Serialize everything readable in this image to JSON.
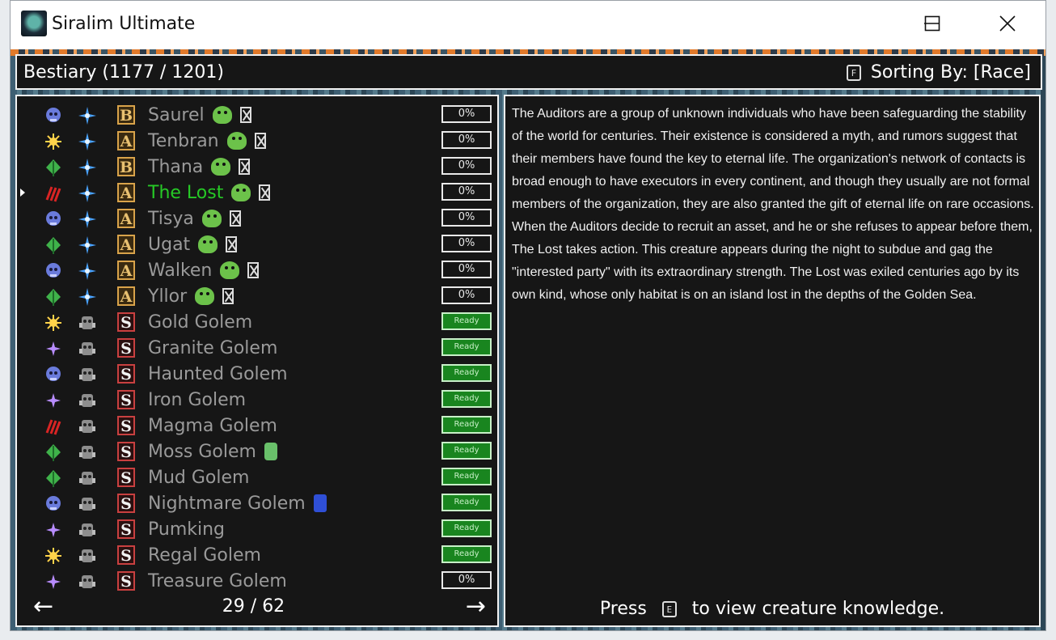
{
  "window": {
    "title": "Siralim Ultimate"
  },
  "header": {
    "title": "Bestiary (1177 / 1201)",
    "sort_key": "F",
    "sort_label": "Sorting By: [Race]"
  },
  "rows": [
    {
      "name": "Saurel",
      "rank": "B",
      "element": "death",
      "race": "star",
      "status": "0%",
      "extra": "blob-x"
    },
    {
      "name": "Tenbran",
      "rank": "A",
      "element": "sun",
      "race": "star",
      "status": "0%",
      "extra": "blob-x"
    },
    {
      "name": "Thana",
      "rank": "B",
      "element": "leaf",
      "race": "star",
      "status": "0%",
      "extra": "blob-x"
    },
    {
      "name": "The Lost",
      "rank": "A",
      "element": "claw",
      "race": "star",
      "status": "0%",
      "extra": "blob-x",
      "selected": true
    },
    {
      "name": "Tisya",
      "rank": "A",
      "element": "death",
      "race": "star",
      "status": "0%",
      "extra": "blob-x"
    },
    {
      "name": "Ugat",
      "rank": "A",
      "element": "leaf",
      "race": "star",
      "status": "0%",
      "extra": "blob-x"
    },
    {
      "name": "Walken",
      "rank": "A",
      "element": "death",
      "race": "star",
      "status": "0%",
      "extra": "blob-x"
    },
    {
      "name": "Yllor",
      "rank": "A",
      "element": "leaf",
      "race": "star",
      "status": "0%",
      "extra": "blob-x"
    },
    {
      "name": "Gold Golem",
      "rank": "S",
      "element": "sun",
      "race": "golem",
      "status": "Ready"
    },
    {
      "name": "Granite Golem",
      "rank": "S",
      "element": "sparkle",
      "race": "golem",
      "status": "Ready"
    },
    {
      "name": "Haunted Golem",
      "rank": "S",
      "element": "death",
      "race": "golem",
      "status": "Ready"
    },
    {
      "name": "Iron Golem",
      "rank": "S",
      "element": "sparkle",
      "race": "golem",
      "status": "Ready"
    },
    {
      "name": "Magma Golem",
      "rank": "S",
      "element": "claw",
      "race": "golem",
      "status": "Ready"
    },
    {
      "name": "Moss Golem",
      "rank": "S",
      "element": "leaf",
      "race": "golem",
      "status": "Ready",
      "extra": "moss"
    },
    {
      "name": "Mud Golem",
      "rank": "S",
      "element": "leaf",
      "race": "golem",
      "status": "Ready"
    },
    {
      "name": "Nightmare Golem",
      "rank": "S",
      "element": "death",
      "race": "golem",
      "status": "Ready",
      "extra": "night"
    },
    {
      "name": "Pumking",
      "rank": "S",
      "element": "sparkle",
      "race": "golem",
      "status": "Ready"
    },
    {
      "name": "Regal Golem",
      "rank": "S",
      "element": "sun",
      "race": "golem",
      "status": "Ready"
    },
    {
      "name": "Treasure Golem",
      "rank": "S",
      "element": "sparkle",
      "race": "golem",
      "status": "0%"
    }
  ],
  "pager": {
    "prev": "←",
    "next": "→",
    "count": "29 / 62"
  },
  "description": "The Auditors are a group of unknown individuals who have been safeguarding the stability of the world for centuries. Their existence is considered a myth, and rumors suggest that their members have found the key to eternal life. The organization's network of contacts is broad enough to have executors in every continent, and though they usually are not formal members of the organization, they are also granted the gift of eternal life on rare occasions. When the Auditors decide to recruit an asset, and he or she refuses to appear before them, The Lost takes action. This creature appears during the night to subdue and gag the \"interested party\" with its extraordinary strength. The Lost was exiled centuries ago by its own kind, whose only habitat is on an island lost in the depths of the Golden Sea.",
  "footer": {
    "press": "Press",
    "key": "E",
    "rest": "to view creature knowledge."
  },
  "colors": {
    "selected": "#26c926",
    "ready": "#19851f",
    "panel": "#161616"
  }
}
